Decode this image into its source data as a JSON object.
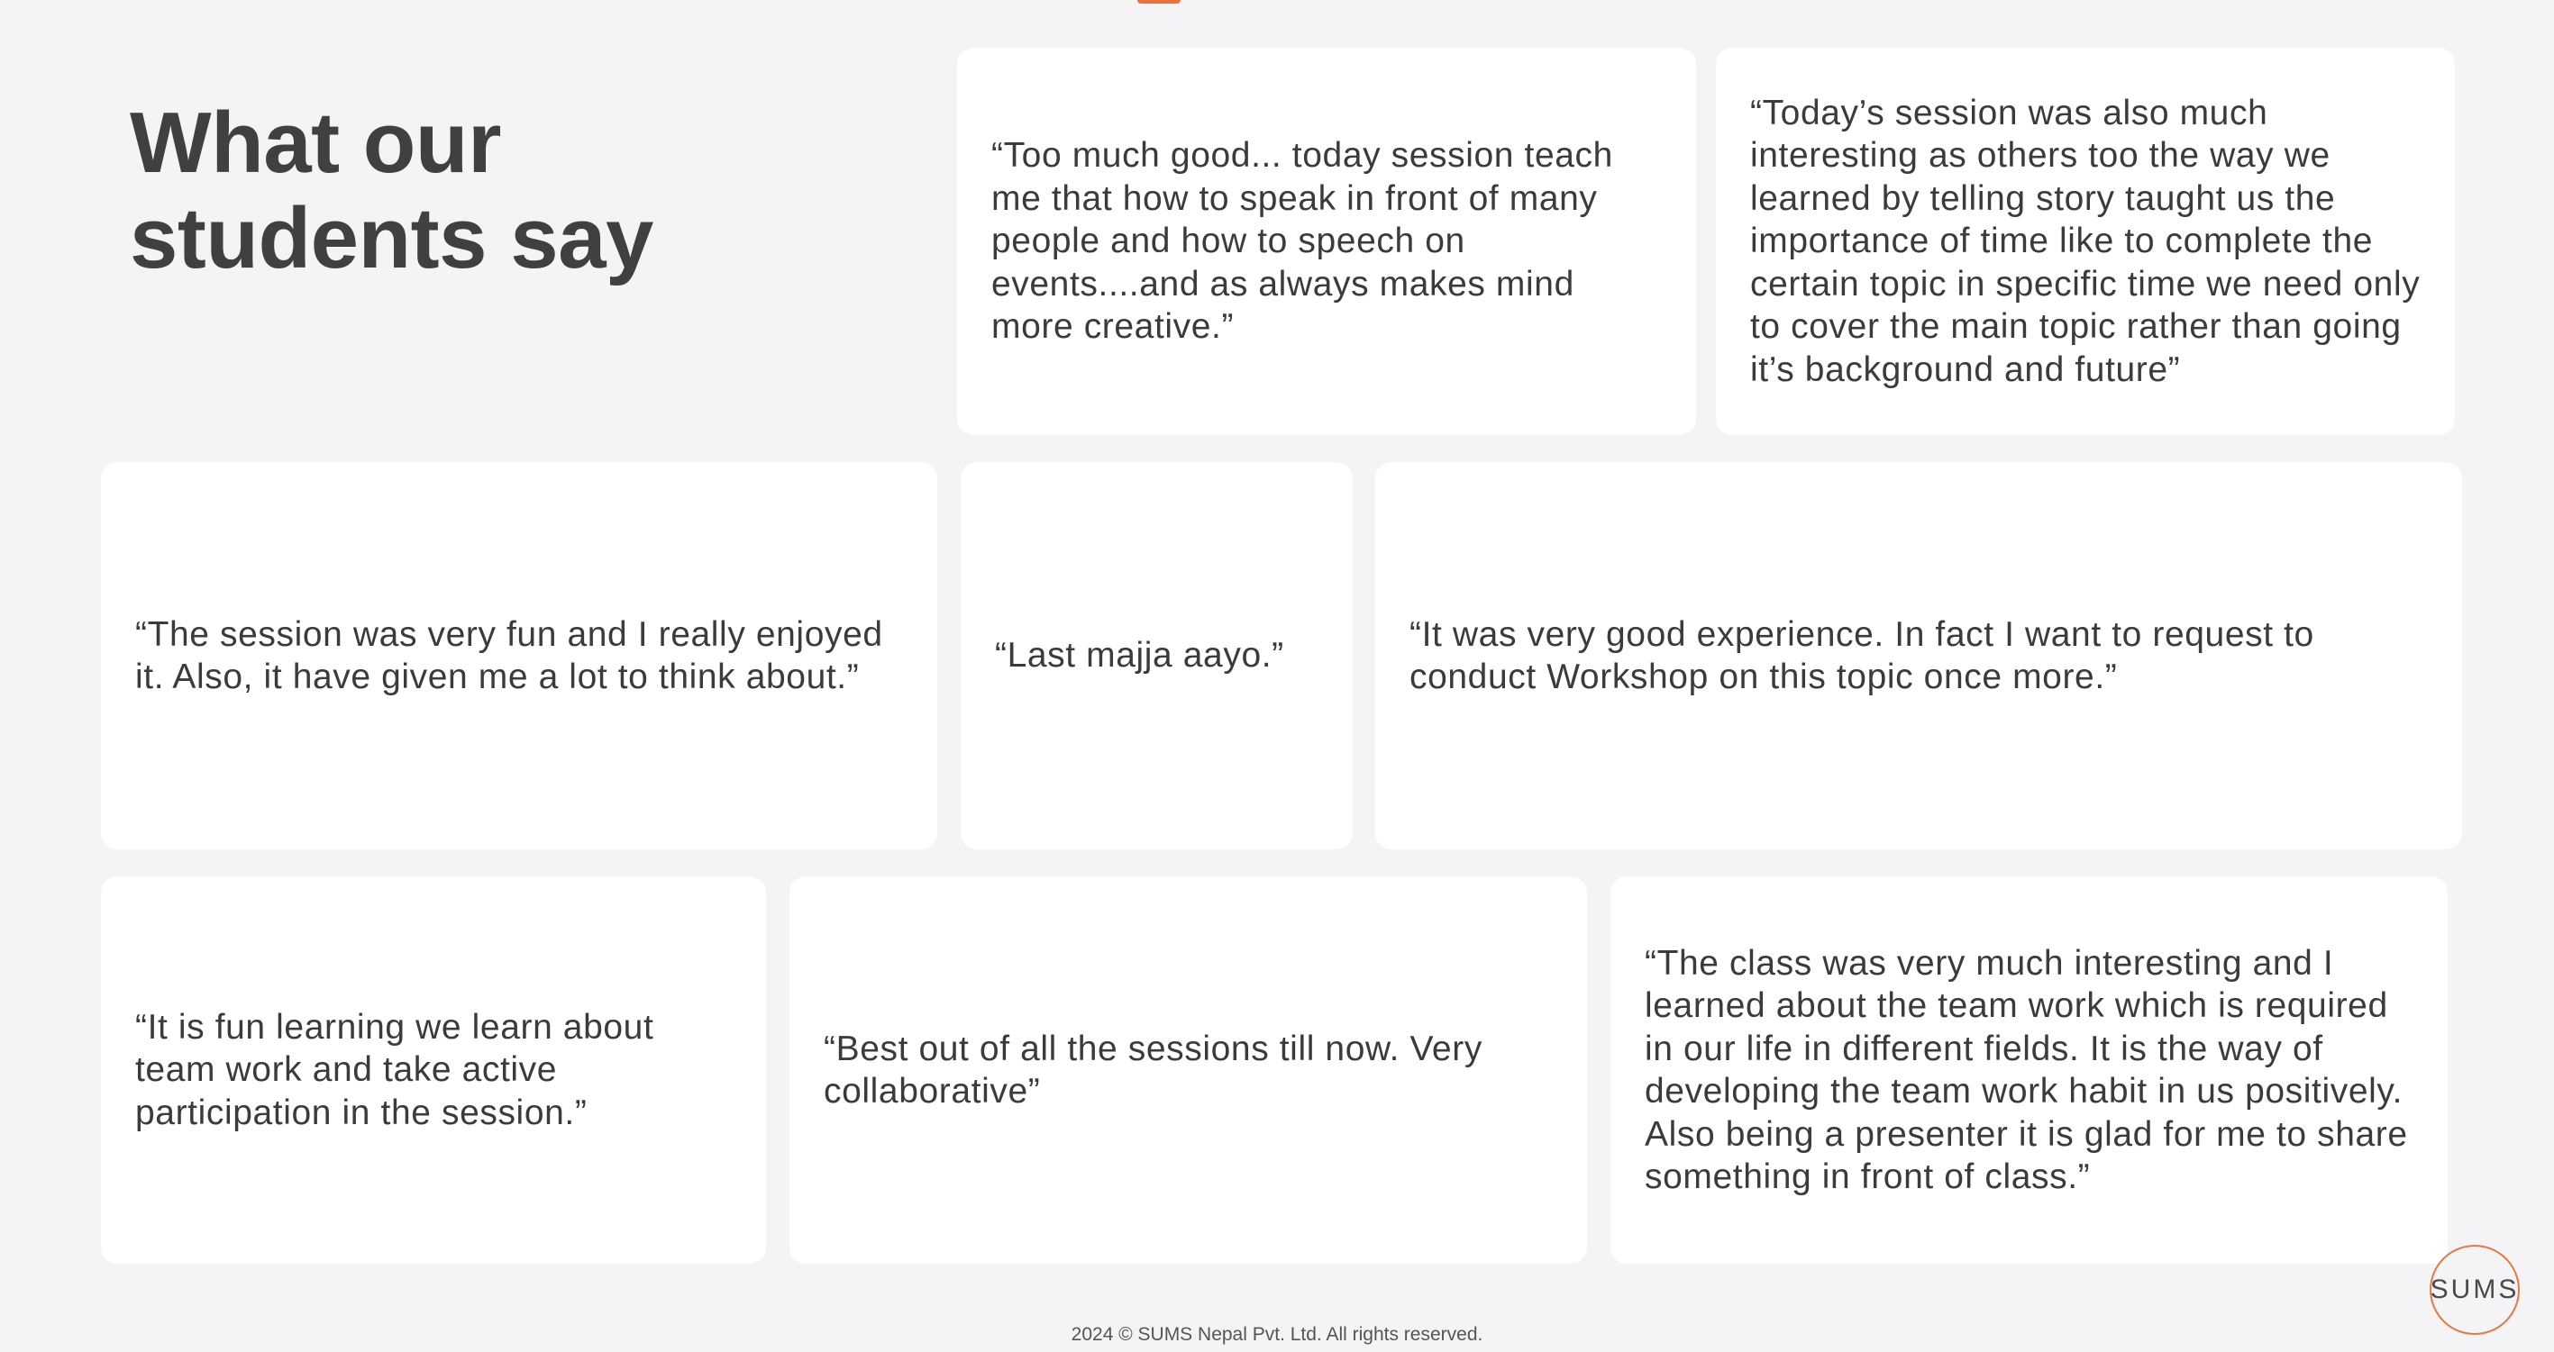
{
  "heading": {
    "line1": "What our",
    "line2": "students say"
  },
  "testimonials": [
    {
      "text": "“Too much good... today session teach me that how to speak in front of many people and how to speech on events....and as always makes mind more creative.”"
    },
    {
      "text": "“Today’s session was also much interesting as others too the way we learned by telling story taught us the importance of time like to complete the certain topic in specific time we need only to cover the main topic rather than going it’s background and future”"
    },
    {
      "text": "“The session was very fun and I really enjoyed it. Also, it have given me a lot to think about.”"
    },
    {
      "text": "“Last majja aayo.”"
    },
    {
      "text": "“It was very good experience. In fact I want to request to conduct Workshop on this topic once more.”"
    },
    {
      "text": "“It is fun learning we learn about team work and take active participation in the session.”"
    },
    {
      "text": "“Best out of all the sessions till now. Very collaborative”"
    },
    {
      "text": "“The class was very much interesting and I learned about the team work which is required in our life in different fields. It is the way of developing the team work habit in us positively. Also being a presenter it is glad for me to share something in front of class.”"
    }
  ],
  "footer": {
    "copyright": "2024 © SUMS Nepal Pvt. Ltd. All rights reserved."
  },
  "logo": {
    "text": "SUMS"
  },
  "colors": {
    "background": "#f4f4f6",
    "card": "#ffffff",
    "accent": "#e27a45",
    "text": "#3f3f3f"
  }
}
